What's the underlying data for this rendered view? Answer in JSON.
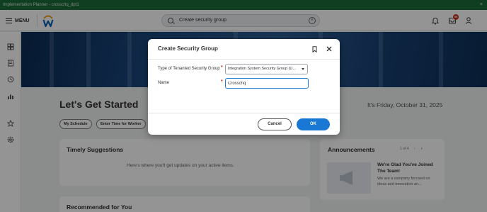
{
  "window": {
    "title": "Implementation Planner - crosschq_dpt1",
    "close_glyph": "×"
  },
  "topbar": {
    "menu_label": "MENU",
    "search_value": "Create security group",
    "notification_count": "59",
    "icons": [
      "bell-icon",
      "inbox-icon",
      "user-icon"
    ]
  },
  "leftnav": {
    "icons": [
      "apps-icon",
      "bookmarks-icon",
      "recent-icon",
      "reports-icon",
      "favorites-icon",
      "settings-icon"
    ]
  },
  "home": {
    "title": "Let's Get Started",
    "date": "It's Friday, October 31, 2025",
    "quick_actions": [
      "My Schedule",
      "Enter Time for Worker"
    ],
    "timely_suggestions": {
      "title": "Timely Suggestions",
      "note": "Here's where you'll get updates on your active items."
    },
    "recommended": {
      "title": "Recommended for You"
    },
    "announcements": {
      "title": "Announcements",
      "pager": "1 of 4",
      "headline": "We're Glad You've Joined The Team!",
      "body": "We are a company focused on ideas and innovation an..."
    }
  },
  "dialog": {
    "title": "Create Security Group",
    "fields": {
      "type_label": "Type of Tenanted Security Group",
      "type_value": "Integration System Security Group (U...",
      "name_label": "Name",
      "name_value": "Crosschq"
    },
    "required_marker": "*",
    "cancel_label": "Cancel",
    "ok_label": "OK"
  },
  "colors": {
    "primary": "#1978d3",
    "required": "#c7321c",
    "titlebar": "#1d6b3a",
    "hero": "#1c4a80"
  }
}
